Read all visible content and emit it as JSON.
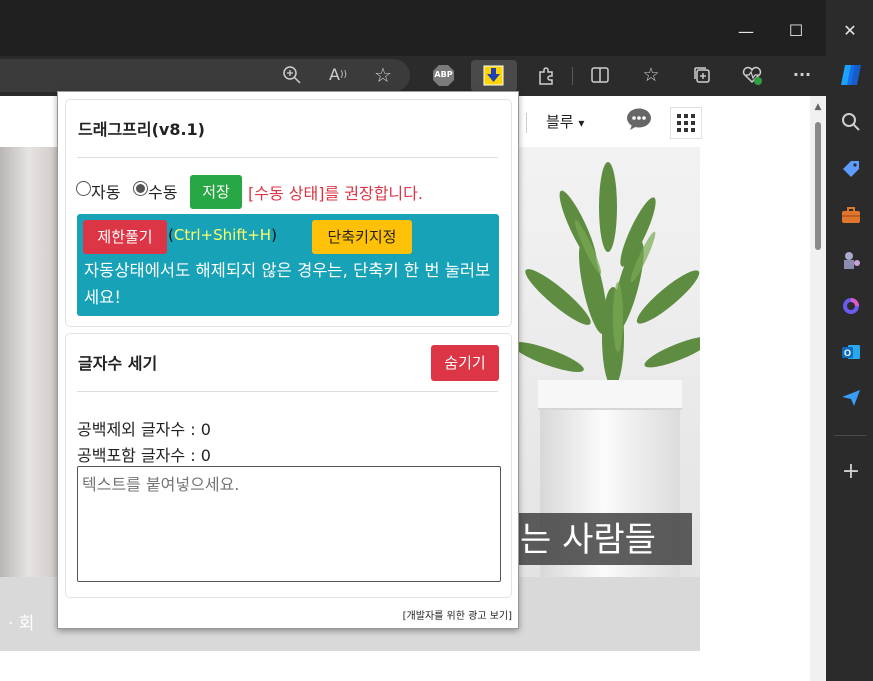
{
  "browser": {
    "window_controls": {
      "minimize": "—",
      "maximize": "☐",
      "close": "✕"
    },
    "toolbar_icons": [
      "zoom-icon",
      "read-aloud-icon",
      "favorite-star-icon",
      "adblock-plus-icon",
      "drag-free-extension-icon",
      "extensions-puzzle-icon",
      "split-screen-icon",
      "favorites-icon",
      "collections-icon",
      "browser-essentials-icon",
      "more-options-icon",
      "copilot-icon"
    ],
    "abp_label": "ABP",
    "more_label": "···"
  },
  "sidebar": {
    "items": [
      {
        "icon": "search-icon",
        "glyph": "⌕",
        "color": "#cfcfcf"
      },
      {
        "icon": "shopping-tag-icon",
        "glyph": "◆",
        "color": "#6aa8ff"
      },
      {
        "icon": "tools-icon",
        "glyph": "▰",
        "color": "#e2782f"
      },
      {
        "icon": "games-icon",
        "glyph": "♜",
        "color": "#b48cd8"
      },
      {
        "icon": "microsoft365-icon",
        "glyph": "◉",
        "color": "#7b6bf3"
      },
      {
        "icon": "outlook-icon",
        "glyph": "O",
        "color": "#1b8ae0"
      },
      {
        "icon": "send-icon",
        "glyph": "➤",
        "color": "#4aa3f5"
      },
      {
        "icon": "add-icon",
        "glyph": "+",
        "color": "#cfcfcf"
      }
    ]
  },
  "page": {
    "blur_label": "블루",
    "blur_caret": "▾",
    "caption": "는 사람들",
    "band_text": "· 회",
    "colors": {
      "leaf": "#5c8a3f"
    }
  },
  "popup": {
    "title": "드래그프리(v8.1)",
    "mode": {
      "auto_label": "자동",
      "manual_label": "수동",
      "selected": "manual",
      "save_label": "저장",
      "hint": "[수동 상태]를 권장합니다."
    },
    "info": {
      "unlock_label": "제한풀기",
      "shortcut_open": "(",
      "shortcut": "Ctrl+Shift+H",
      "shortcut_close": ")",
      "set_shortcut_label": "단축키지정",
      "message": "자동상태에서도 해제되지 않은 경우는, 단축키 한 번 눌러보세요!"
    },
    "counter": {
      "title": "글자수 세기",
      "hide_label": "숨기기",
      "without_spaces_label": "공백제외 글자수 : ",
      "without_spaces_value": "0",
      "with_spaces_label": "공백포함 글자수 : ",
      "with_spaces_value": "0",
      "textarea_placeholder": "텍스트를 붙여넣으세요."
    },
    "ad_link": "[개발자를 위한 광고 보기]",
    "colors": {
      "green": "#28a745",
      "red": "#dc3545",
      "teal": "#17a2b8",
      "yellow": "#ffc107",
      "hint_red": "#dc3545",
      "shortcut_yellow": "#ffff66"
    }
  }
}
